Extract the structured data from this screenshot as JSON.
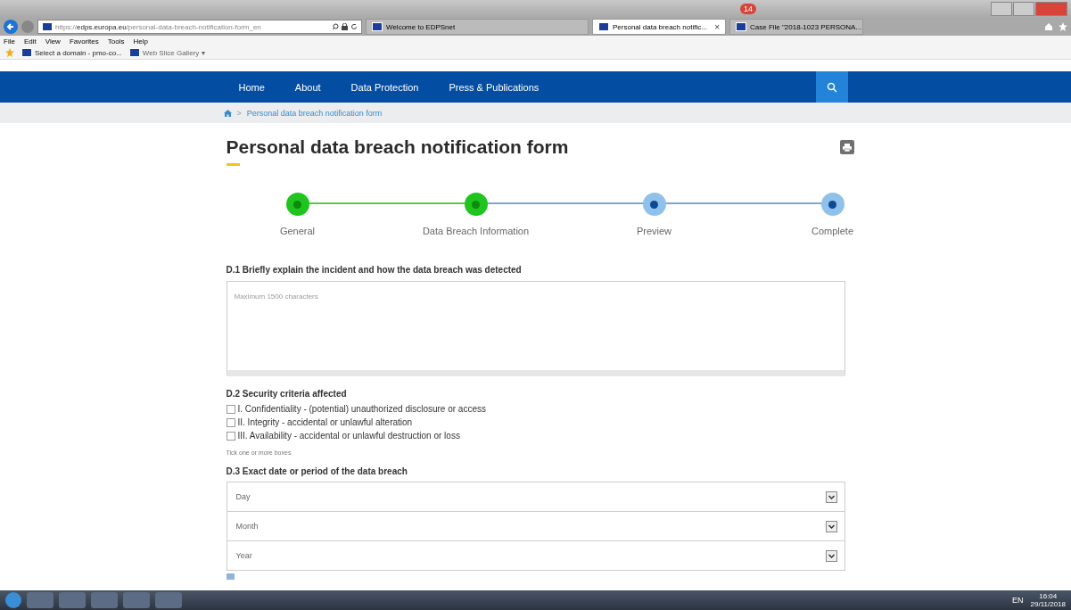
{
  "browser": {
    "notification_badge": "14",
    "address": {
      "prefix": "https://",
      "domain": "edps.europa.eu",
      "path": "/personal-data-breach-notification-form_en"
    },
    "tabs": [
      {
        "label": "Welcome to EDPSnet",
        "selected": false
      },
      {
        "label": "Personal data breach notific...",
        "selected": true,
        "close": "×"
      },
      {
        "label": "Case File \"2018-1023 PERSONA...",
        "selected": false
      }
    ],
    "menu": [
      "File",
      "Edit",
      "View",
      "Favorites",
      "Tools",
      "Help"
    ],
    "favorites": [
      {
        "label": "Select a domain - pmo-co..."
      },
      {
        "label": "Web Slice Gallery",
        "caret": "▾"
      }
    ]
  },
  "nav": {
    "items": [
      "Home",
      "About",
      "Data Protection",
      "Press & Publications"
    ]
  },
  "breadcrumb": {
    "separator": ">",
    "current": "Personal data breach notification form"
  },
  "page_title": "Personal data breach notification form",
  "steps": [
    {
      "label": "General",
      "done": true
    },
    {
      "label": "Data Breach Information",
      "done": true
    },
    {
      "label": "Preview",
      "done": false
    },
    {
      "label": "Complete",
      "done": false
    }
  ],
  "d1": {
    "label": "D.1 Briefly explain the incident and how the data breach was detected",
    "placeholder": "Maximum 1500 characters"
  },
  "d2": {
    "label": "D.2 Security criteria affected",
    "options": [
      {
        "label": "I. Confidentiality - (potential) unauthorized disclosure or access",
        "checked": false
      },
      {
        "label": "II. Integrity - accidental or unlawful alteration",
        "checked": false
      },
      {
        "label": "III. Availability - accidental or unlawful destruction or loss",
        "checked": false
      }
    ],
    "hint": "Tick one or more boxes"
  },
  "d3": {
    "label": "D.3 Exact date or period of the data breach",
    "selects": [
      "Day",
      "Month",
      "Year"
    ]
  },
  "taskbar": {
    "language": "EN",
    "time": "16:04",
    "date": "29/11/2018"
  }
}
